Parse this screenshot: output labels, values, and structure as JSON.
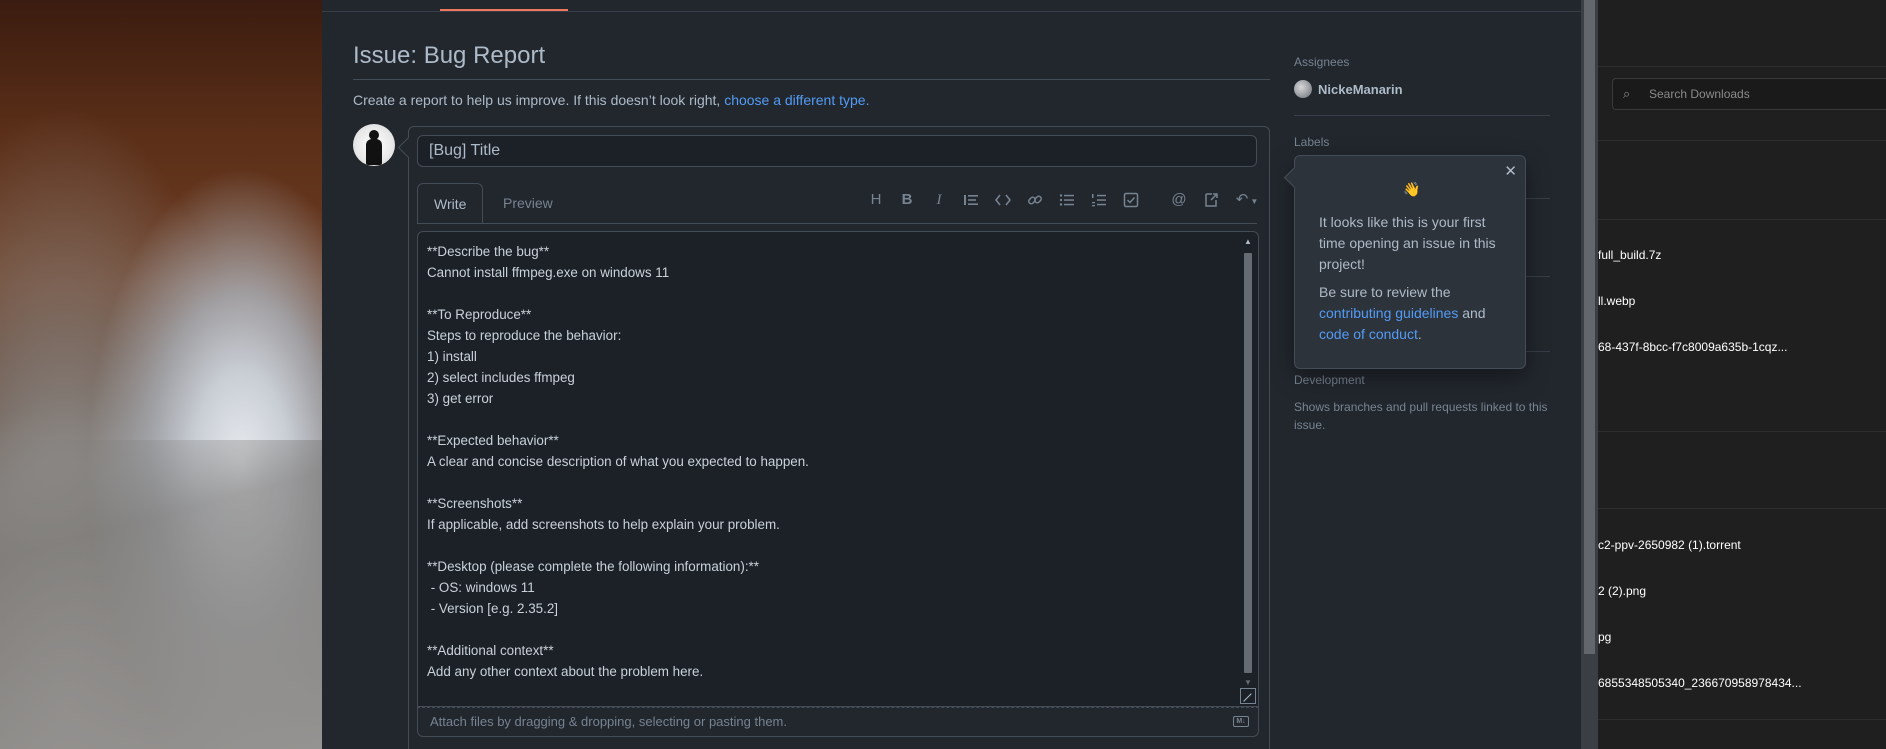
{
  "issue": {
    "title": "Issue: Bug Report",
    "description": "Create a report to help us improve. If this doesn’t look right, ",
    "description_link": "choose a different type.",
    "title_field_value": "[Bug] Title",
    "tabs": [
      "Write",
      "Preview"
    ],
    "body_lines": [
      "**Describe the bug**",
      "Cannot install ffmpeg.exe on windows 11",
      "",
      "**To Reproduce**",
      "Steps to reproduce the behavior:",
      "1) install",
      "2) select includes ffmpeg",
      "3) get error",
      "",
      "**Expected behavior**",
      "A clear and concise description of what you expected to happen.",
      "",
      "**Screenshots**",
      "If applicable, add screenshots to help explain your problem.",
      "",
      "**Desktop (please complete the following information):**",
      " - OS: windows 11",
      " - Version [e.g. 2.35.2]",
      "",
      "**Additional context**",
      "Add any other context about the problem here."
    ],
    "attach_hint": "Attach files by dragging & dropping, selecting or pasting them.",
    "toolbar_icons": [
      "heading-icon",
      "bold-icon",
      "italic-icon",
      "quote-icon",
      "code-icon",
      "link-icon",
      "unordered-list-icon",
      "ordered-list-icon",
      "task-list-icon",
      "mention-icon",
      "reference-icon",
      "undo-icon"
    ]
  },
  "sidebar": {
    "assignees_label": "Assignees",
    "assignee_name": "NickeManarin",
    "labels_label": "Labels",
    "development_label": "Development",
    "development_desc": "Shows branches and pull requests linked to this issue."
  },
  "popover": {
    "wave": "👋",
    "text1": "It looks like this is your first time opening an issue in this project!",
    "text2_prefix": "Be sure to review the ",
    "link1": "contributing guidelines",
    "text2_mid": " and",
    "link2": "code of conduct",
    "text2_suffix": "."
  },
  "downloads": {
    "search_placeholder": "Search Downloads",
    "items": [
      "full_build.7z",
      "ll.webp",
      "68-437f-8bcc-f7c8009a635b-1cqz...",
      "c2-ppv-2650982 (1).torrent",
      "2 (2).png",
      "pg",
      "6855348505340_236670958978434..."
    ]
  },
  "colors": {
    "panel_bg": "#22272e",
    "accent_link": "#539bf5",
    "tab_underline": "#ec775c"
  }
}
